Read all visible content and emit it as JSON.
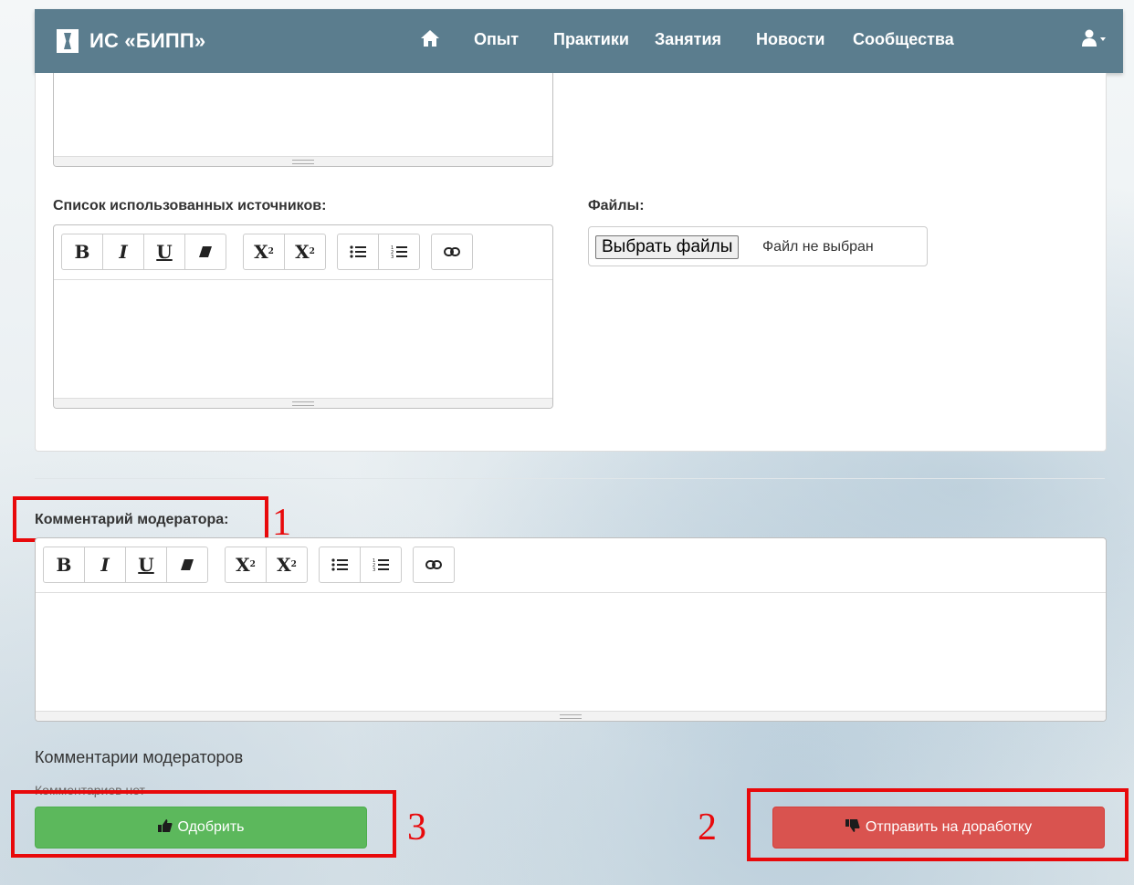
{
  "navbar": {
    "brand": "ИС «БИПП»",
    "home_icon": "home-icon",
    "links": [
      "Опыт",
      "Практики",
      "Занятия",
      "Новости",
      "Сообщества"
    ],
    "user_icon": "user-dropdown-icon",
    "background": "#5b7d8e"
  },
  "form": {
    "sources_label": "Список использованных источников:",
    "files_label": "Файлы:",
    "file_button": "Выбрать файлы",
    "file_status": "Файл не выбран"
  },
  "toolbar": {
    "bold": "B",
    "italic": "I",
    "underline": "U",
    "eraser": "eraser-icon",
    "superscript": "X",
    "subscript": "X",
    "ul": "unordered-list-icon",
    "ol": "ordered-list-icon",
    "link": "link-icon"
  },
  "moderator": {
    "comment_label": "Комментарий модератора:",
    "comments_title": "Комментарии модераторов",
    "no_comments": "Комментариев нет"
  },
  "buttons": {
    "approve": "Одобрить",
    "rework": "Отправить на доработку",
    "approve_color": "#5cb85c",
    "rework_color": "#d9534f"
  },
  "annotations": {
    "one": "1",
    "two": "2",
    "three": "3",
    "color": "#e8090b"
  }
}
